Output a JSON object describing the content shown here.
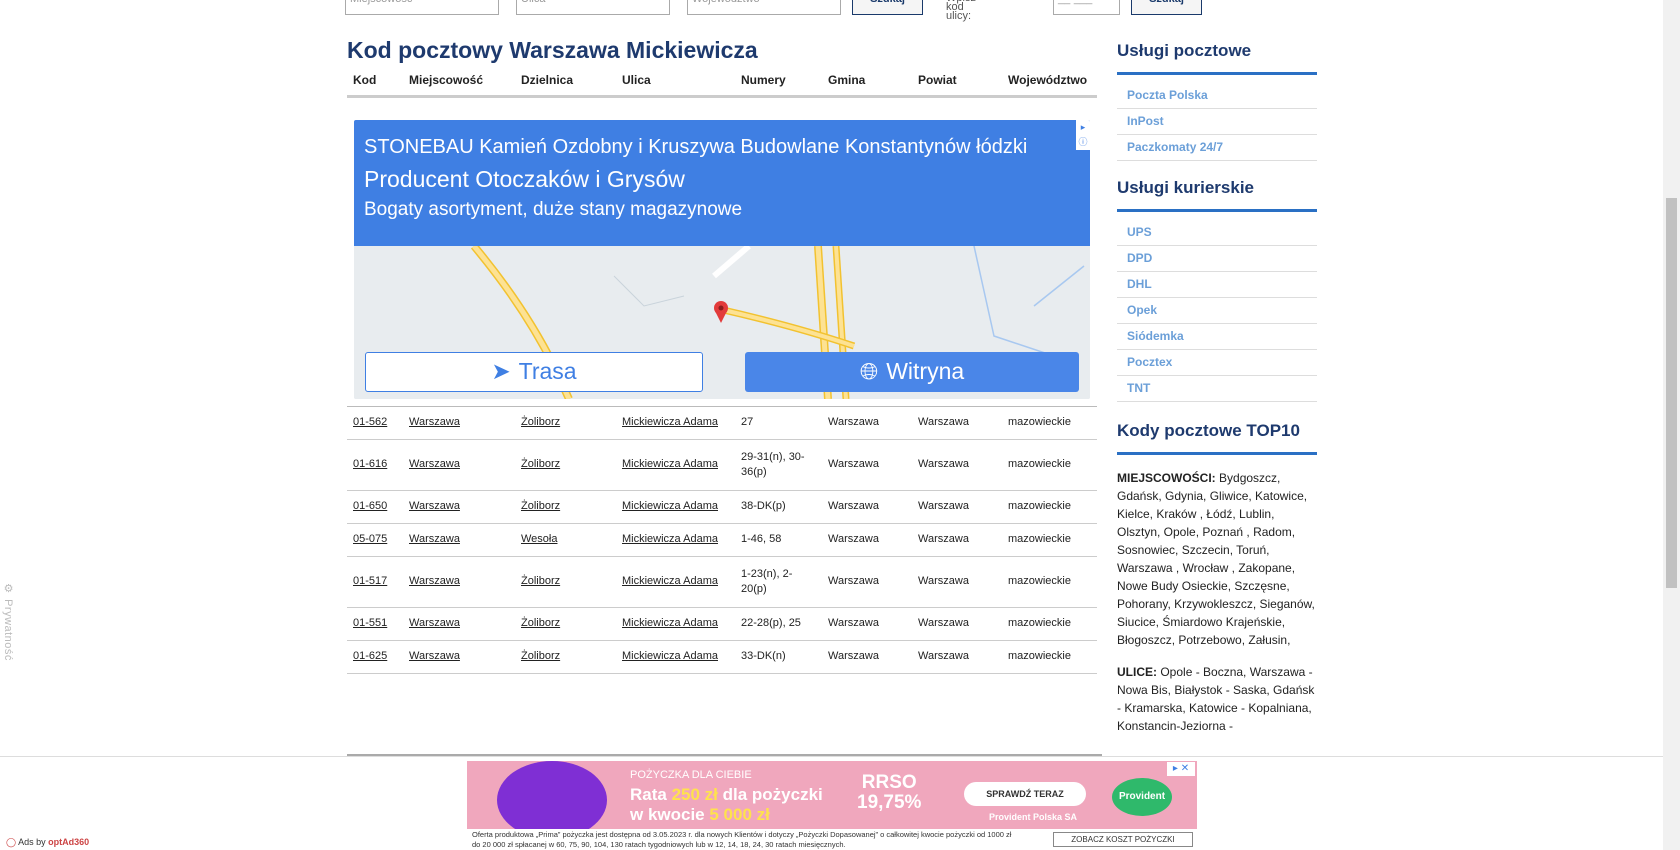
{
  "search": {
    "city_placeholder": "Miejscowość",
    "street_placeholder": "Ulica",
    "region_placeholder": "Województwo",
    "search_label": "Szukaj",
    "street_code_label": "Wpisz kod ulicy:",
    "code_placeholder": "__-___",
    "search_label_2": "Szukaj"
  },
  "main": {
    "title": "Kod pocztowy Warszawa Mickiewicza",
    "columns": [
      "Kod",
      "Miejscowość",
      "Dzielnica",
      "Ulica",
      "Numery",
      "Gmina",
      "Powiat",
      "Województwo"
    ],
    "rows": [
      {
        "kod": "01-562",
        "miejscowosc": "Warszawa",
        "dzielnica": "Żoliborz",
        "ulica": "Mickiewicza Adama",
        "numery": "27",
        "gmina": "Warszawa",
        "powiat": "Warszawa",
        "woj": "mazowieckie"
      },
      {
        "kod": "01-616",
        "miejscowosc": "Warszawa",
        "dzielnica": "Żoliborz",
        "ulica": "Mickiewicza Adama",
        "numery": "29-31(n), 30-36(p)",
        "gmina": "Warszawa",
        "powiat": "Warszawa",
        "woj": "mazowieckie"
      },
      {
        "kod": "01-650",
        "miejscowosc": "Warszawa",
        "dzielnica": "Żoliborz",
        "ulica": "Mickiewicza Adama",
        "numery": "38-DK(p)",
        "gmina": "Warszawa",
        "powiat": "Warszawa",
        "woj": "mazowieckie"
      },
      {
        "kod": "05-075",
        "miejscowosc": "Warszawa",
        "dzielnica": "Wesoła",
        "ulica": "Mickiewicza Adama",
        "numery": "1-46, 58",
        "gmina": "Warszawa",
        "powiat": "Warszawa",
        "woj": "mazowieckie"
      },
      {
        "kod": "01-517",
        "miejscowosc": "Warszawa",
        "dzielnica": "Żoliborz",
        "ulica": "Mickiewicza Adama",
        "numery": "1-23(n), 2-20(p)",
        "gmina": "Warszawa",
        "powiat": "Warszawa",
        "woj": "mazowieckie"
      },
      {
        "kod": "01-551",
        "miejscowosc": "Warszawa",
        "dzielnica": "Żoliborz",
        "ulica": "Mickiewicza Adama",
        "numery": "22-28(p), 25",
        "gmina": "Warszawa",
        "powiat": "Warszawa",
        "woj": "mazowieckie"
      },
      {
        "kod": "01-625",
        "miejscowosc": "Warszawa",
        "dzielnica": "Żoliborz",
        "ulica": "Mickiewicza Adama",
        "numery": "33-DK(n)",
        "gmina": "Warszawa",
        "powiat": "Warszawa",
        "woj": "mazowieckie"
      }
    ]
  },
  "ad": {
    "line1": "STONEBAU Kamień Ozdobny i Kruszywa Budowlane Konstantynów łódzki",
    "line2": "Producent Otoczaków i Grysów",
    "line3": "Bogaty asortyment, duże stany magazynowe",
    "btn_trasa": "Trasa",
    "btn_witryna": "Witryna"
  },
  "sidebar": {
    "postal_title": "Usługi pocztowe",
    "postal_items": [
      "Poczta Polska",
      "InPost",
      "Paczkomaty 24/7"
    ],
    "courier_title": "Usługi kurierskie",
    "courier_items": [
      "UPS",
      "DPD",
      "DHL",
      "Opek",
      "Siódemka",
      "Pocztex",
      "TNT"
    ],
    "top10_title": "Kody pocztowe TOP10",
    "cities_label": "MIEJSCOWOŚCI:",
    "cities": "Bydgoszcz, Gdańsk, Gdynia, Gliwice, Katowice, Kielce, Kraków , Łódź, Lublin, Olsztyn, Opole, Poznań , Radom, Sosnowiec, Szczecin, Toruń, Warszawa , Wrocław , Zakopane, Nowe Budy Osieckie, Szczęsne, Pohorany, Krzywokleszcz, Sieganów, Siucice, Śmiardowo Krajeńskie, Błogoszcz, Potrzebowo, Załusin,",
    "streets_label": "ULICE:",
    "streets": "Opole - Boczna, Warszawa - Nowa Bis, Białystok - Saska, Gdańsk - Kramarska, Katowice - Kopalniana, Konstancin-Jeziorna -"
  },
  "privacy_label": "Prywatność",
  "bottom_ad": {
    "ads_by": "Ads by ",
    "ads_brand": "optAd360",
    "kicker": "POŻYCZKA DLA CIEBIE",
    "rata_a": "Rata ",
    "rata_amount": "250 zł",
    "rata_b": " dla pożyczki",
    "kwota_a": "w kwocie ",
    "kwota_amount": "5 000 zł",
    "rrso_label": "RRSO",
    "rrso_value": "19,75%",
    "cta": "SPRAWDŹ TERAZ",
    "brand_sub": "Provident Polska SA",
    "brand_logo": "Provident",
    "disclaimer": "Oferta produktowa „Prima” pożyczka jest dostępna od 3.05.2023 r. dla nowych Klientów i dotyczy „Pożyczki Dopasowanej” o całkowitej kwocie pożyczki od 1000 zł do 20 000 zł spłacanej w 60, 75, 90, 104, 130 ratach tygodniowych lub w 12, 14, 18, 24, 30 ratach miesięcznych.",
    "koszt": "ZOBACZ KOSZT POŻYCZKI"
  }
}
